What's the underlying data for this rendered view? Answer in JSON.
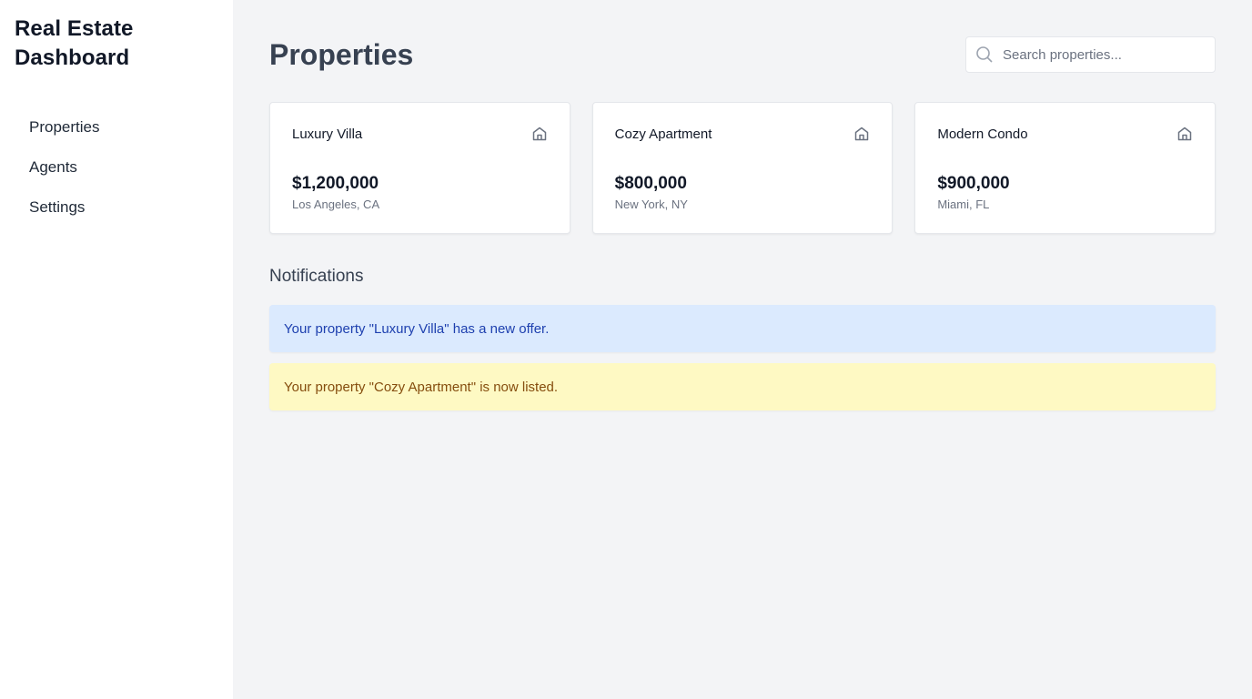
{
  "sidebar": {
    "brand": "Real Estate Dashboard",
    "items": [
      {
        "label": "Properties"
      },
      {
        "label": "Agents"
      },
      {
        "label": "Settings"
      }
    ]
  },
  "header": {
    "title": "Properties",
    "search": {
      "placeholder": "Search properties...",
      "value": ""
    }
  },
  "properties": [
    {
      "name": "Luxury Villa",
      "price": "$1,200,000",
      "location": "Los Angeles, CA",
      "icon": "home-icon"
    },
    {
      "name": "Cozy Apartment",
      "price": "$800,000",
      "location": "New York, NY",
      "icon": "home-icon"
    },
    {
      "name": "Modern Condo",
      "price": "$900,000",
      "location": "Miami, FL",
      "icon": "home-icon"
    }
  ],
  "notifications": {
    "title": "Notifications",
    "items": [
      {
        "text": "Your property \"Luxury Villa\" has a new offer.",
        "type": "info",
        "color": "#dbeafe"
      },
      {
        "text": "Your property \"Cozy Apartment\" is now listed.",
        "type": "warning",
        "color": "#fef9c3"
      }
    ]
  }
}
